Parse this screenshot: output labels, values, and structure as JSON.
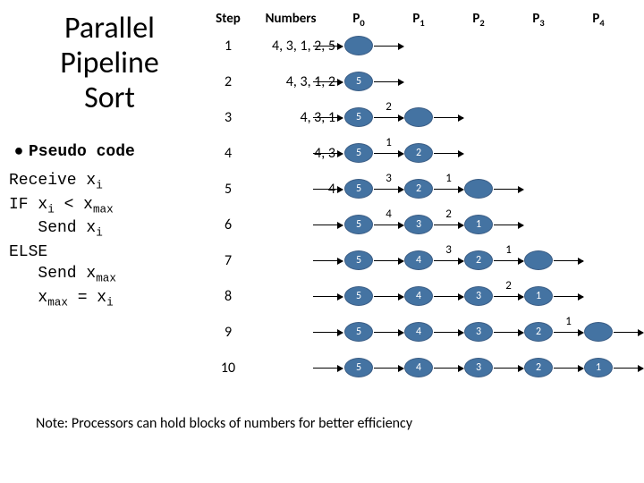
{
  "title_l1": "Parallel",
  "title_l2": "Pipeline",
  "title_l3": "Sort",
  "bullet_label": "Pseudo code",
  "pseudo_lines": [
    "Receive x_i",
    "IF x_i < x_max",
    "   Send x_i",
    "ELSE",
    "   Send x_max",
    "   x_max = x_i"
  ],
  "headers": {
    "step": "Step",
    "numbers": "Numbers"
  },
  "processors": [
    "P_0",
    "P_1",
    "P_2",
    "P_3",
    "P_4"
  ],
  "note": "Note: Processors can hold blocks of numbers for better efficiency",
  "chart_data": {
    "type": "table",
    "title": "Parallel Pipeline Sort trace",
    "steps": [
      {
        "step": 1,
        "numbers": "4, 3, 1, 2, 5",
        "ovals": [
          ""
        ],
        "sends": []
      },
      {
        "step": 2,
        "numbers": "4, 3, 1, 2",
        "ovals": [
          "5"
        ],
        "sends": []
      },
      {
        "step": 3,
        "numbers": "4, 3, 1",
        "ovals": [
          "5",
          ""
        ],
        "sends": [
          "2"
        ]
      },
      {
        "step": 4,
        "numbers": "4, 3",
        "ovals": [
          "5",
          "2"
        ],
        "sends": [
          "1"
        ]
      },
      {
        "step": 5,
        "numbers": "4",
        "ovals": [
          "5",
          "2",
          ""
        ],
        "sends": [
          "3",
          "1"
        ]
      },
      {
        "step": 6,
        "numbers": "",
        "ovals": [
          "5",
          "3",
          "1"
        ],
        "sends": [
          "4",
          "2"
        ]
      },
      {
        "step": 7,
        "numbers": "",
        "ovals": [
          "5",
          "4",
          "2",
          ""
        ],
        "sends": [
          "",
          "3",
          "1"
        ]
      },
      {
        "step": 8,
        "numbers": "",
        "ovals": [
          "5",
          "4",
          "3",
          "1"
        ],
        "sends": [
          "",
          "",
          "2"
        ]
      },
      {
        "step": 9,
        "numbers": "",
        "ovals": [
          "5",
          "4",
          "3",
          "2",
          ""
        ],
        "sends": [
          "",
          "",
          "",
          "1"
        ]
      },
      {
        "step": 10,
        "numbers": "",
        "ovals": [
          "5",
          "4",
          "3",
          "2",
          "1"
        ],
        "sends": []
      }
    ]
  }
}
